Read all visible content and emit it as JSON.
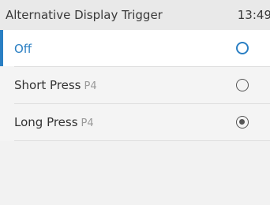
{
  "header": {
    "title": "Alternative Display Trigger",
    "time": "13:49"
  },
  "options": [
    {
      "label": "Off",
      "sub": "",
      "checked": false,
      "focused": true
    },
    {
      "label": "Short Press",
      "sub": "P4",
      "checked": false,
      "focused": false
    },
    {
      "label": "Long Press",
      "sub": "P4",
      "checked": true,
      "focused": false
    }
  ]
}
